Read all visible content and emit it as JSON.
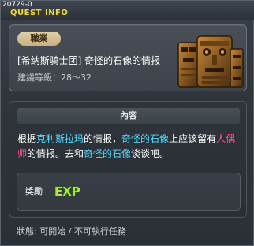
{
  "window": {
    "quest_id": "20729-0",
    "title": "QUEST INFO"
  },
  "card": {
    "job_label": "職業",
    "quest_name": "[希纳斯骑士团] 奇怪的石像的情报",
    "recommended_level": "建議等級：28～32",
    "image_icon": "stone-statue-icon"
  },
  "content": {
    "header": "內容",
    "text_parts": {
      "p1": "根据",
      "p2": "克利斯拉玛",
      "p3": "的情报，",
      "p4": "奇怪的石像",
      "p5": "上应该留有",
      "p6": "人偶师",
      "p7": "的情报。去和",
      "p8": "奇怪的石像",
      "p9": "谈谈吧。"
    }
  },
  "reward": {
    "label": "獎勵",
    "exp_icon_text": "EXP"
  },
  "status_line": "狀態:  可開始 / 不可執行任務",
  "colors": {
    "title_yellow": "#f2d83a",
    "highlight_teal": "#55d9ff",
    "highlight_pink": "#ff4d9a",
    "exp_green": "#a8e83a"
  }
}
